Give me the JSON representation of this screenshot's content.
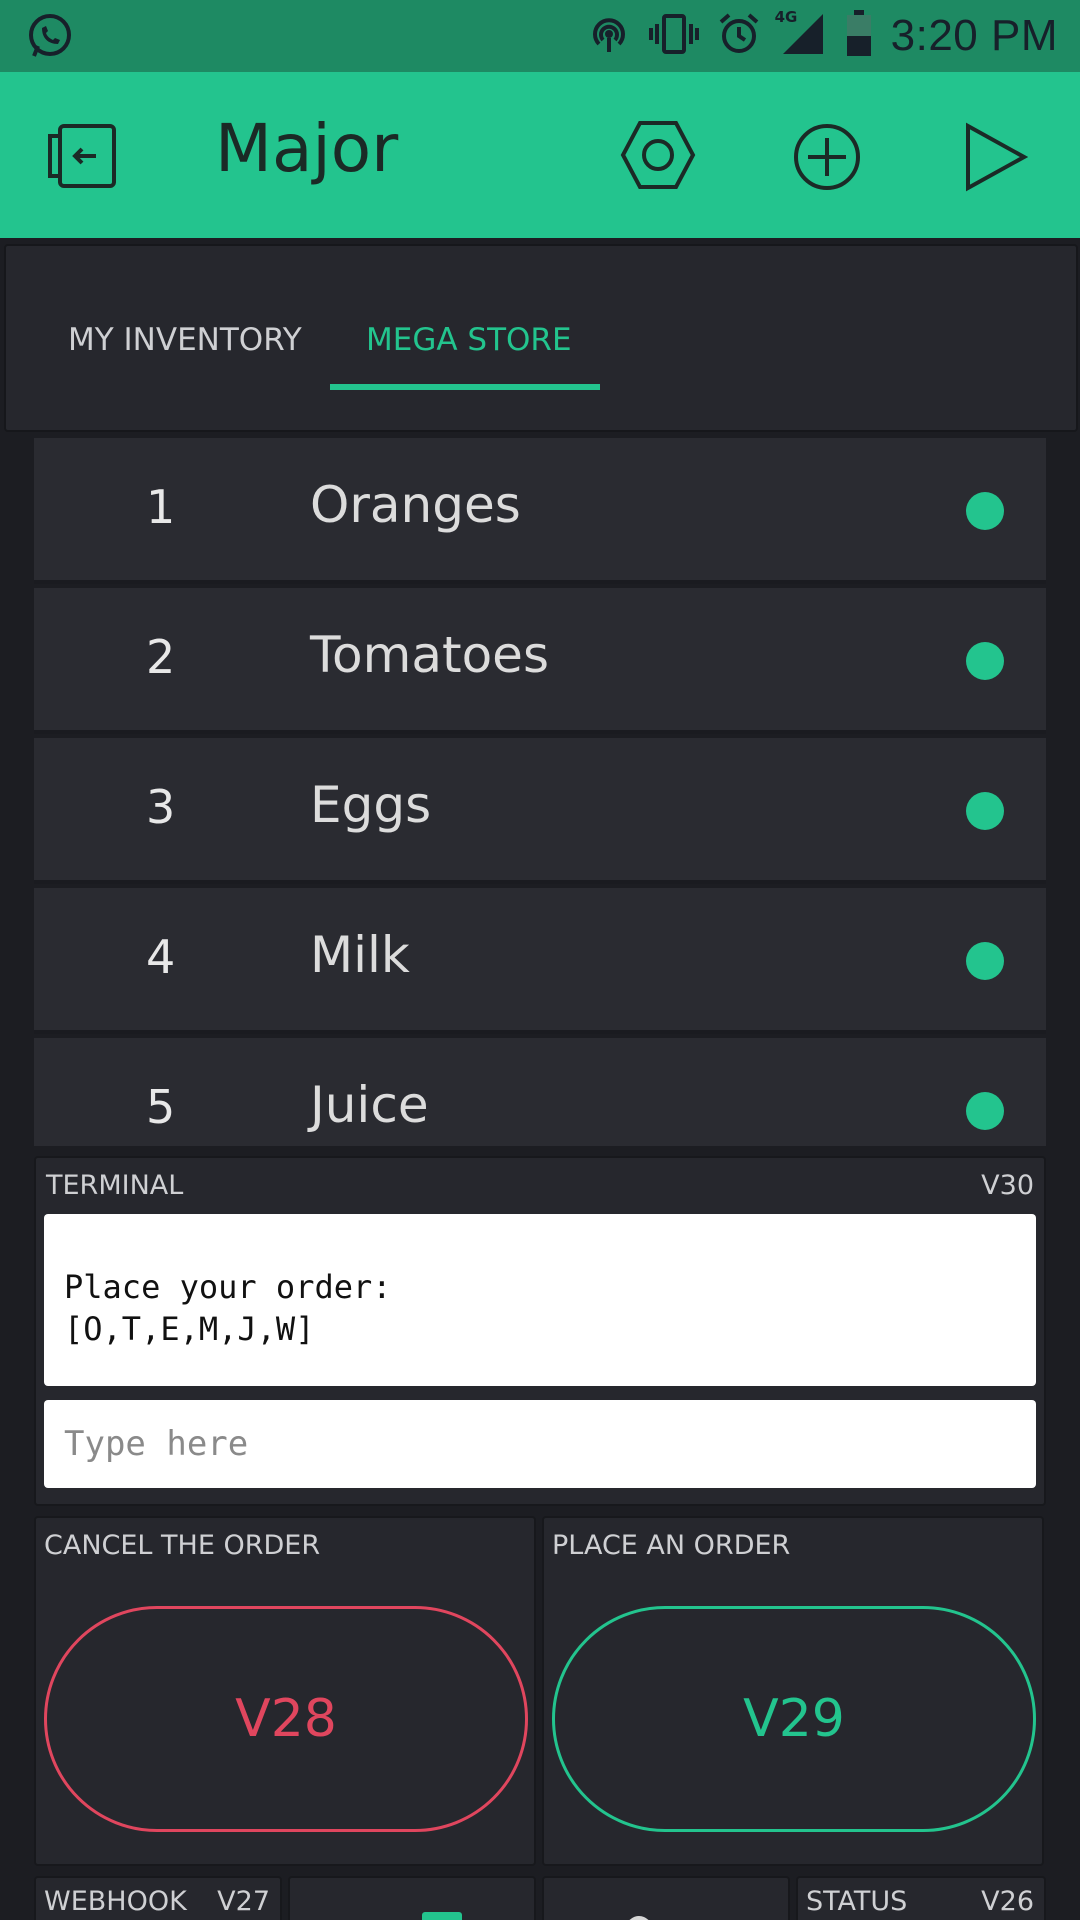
{
  "status_bar": {
    "time": "3:20 PM",
    "network": "4G",
    "icons": [
      "whatsapp-icon",
      "hotspot-icon",
      "vibrate-icon",
      "alarm-icon",
      "signal-icon",
      "battery-icon"
    ]
  },
  "app_bar": {
    "title": "Major",
    "icons": [
      "exit-icon",
      "settings-hexagon-icon",
      "add-circle-icon",
      "play-icon"
    ]
  },
  "tabs": [
    {
      "label": "MY INVENTORY",
      "active": false
    },
    {
      "label": "MEGA STORE",
      "active": true
    }
  ],
  "table": {
    "rows": [
      {
        "num": "1",
        "name": "Oranges"
      },
      {
        "num": "2",
        "name": "Tomatoes"
      },
      {
        "num": "3",
        "name": "Eggs"
      },
      {
        "num": "4",
        "name": "Milk"
      },
      {
        "num": "5",
        "name": "Juice"
      }
    ]
  },
  "terminal": {
    "label": "TERMINAL",
    "pin": "V30",
    "output": "Place your order:\n[O,T,E,M,J,W]",
    "placeholder": "Type here"
  },
  "buttons": {
    "cancel": {
      "label": "CANCEL THE ORDER",
      "pin": "V28"
    },
    "place": {
      "label": "PLACE AN ORDER",
      "pin": "V29"
    }
  },
  "bottom_widgets": {
    "webhook": {
      "label": "WEBHOOK",
      "pin": "V27"
    },
    "status": {
      "label": "STATUS",
      "pin": "V26"
    }
  },
  "colors": {
    "accent": "#23c48e",
    "danger": "#e0465e",
    "status_bar": "#1e8a63",
    "background": "#1c1d22"
  }
}
